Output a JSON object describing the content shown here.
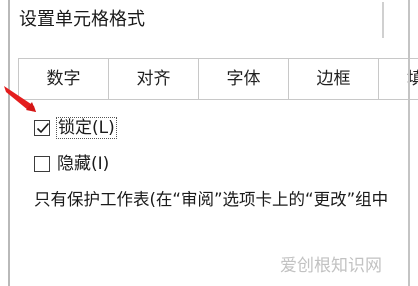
{
  "dialog": {
    "title": "设置单元格格式"
  },
  "tabs": [
    {
      "label": "数字"
    },
    {
      "label": "对齐"
    },
    {
      "label": "字体"
    },
    {
      "label": "边框"
    },
    {
      "label": "填"
    }
  ],
  "protection": {
    "locked": {
      "label": "锁定(L)",
      "checked": true
    },
    "hidden": {
      "label": "隐藏(I)",
      "checked": false
    },
    "description": "只有保护工作表(在“审阅”选项卡上的“更改”组中"
  },
  "watermark": "爱创根知识网",
  "colors": {
    "pointer": "#e41e1e",
    "check": "#1a1a1a"
  },
  "icons": {
    "pointer": "red-arrow-icon",
    "check": "checkmark-icon"
  }
}
